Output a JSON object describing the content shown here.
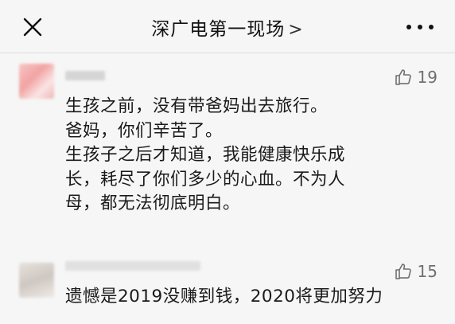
{
  "header": {
    "title": "深广电第一现场",
    "chevron": ">",
    "close_icon": "close-icon",
    "more_icon": "more-horizontal-icon"
  },
  "comments": [
    {
      "like_count": "19",
      "lines": [
        "生孩之前，没有带爸妈出去旅行。",
        "爸妈，你们辛苦了。",
        "生孩子之后才知道，我能健康快乐成",
        "长，耗尽了你们多少的心血。不为人",
        "母，都无法彻底明白。"
      ]
    },
    {
      "like_count": "15",
      "lines": [
        "遗憾是2019没赚到钱，2020将更加努力"
      ]
    }
  ],
  "colors": {
    "background": "#f6f6f6",
    "text": "#1a1a1a",
    "meta": "#6f6f6f"
  }
}
